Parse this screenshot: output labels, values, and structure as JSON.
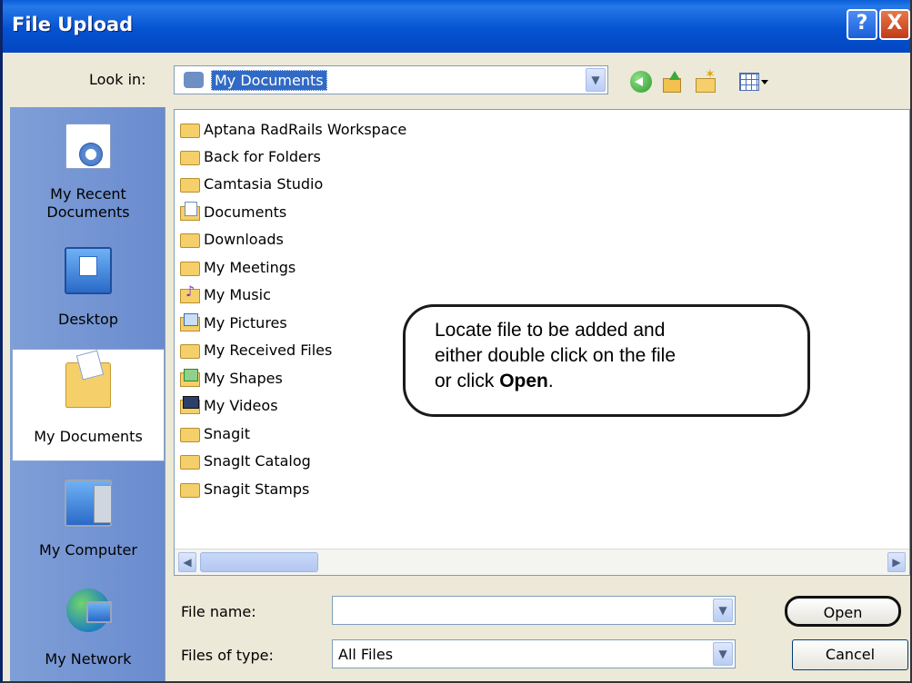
{
  "window": {
    "title": "File Upload"
  },
  "title_buttons": {
    "help": "?",
    "close": "X"
  },
  "look_in": {
    "label": "Look in:",
    "value": "My Documents"
  },
  "places": [
    {
      "label": "My Recent\nDocuments",
      "icon": "recent-documents-icon"
    },
    {
      "label": "Desktop",
      "icon": "desktop-icon"
    },
    {
      "label": "My Documents",
      "icon": "my-documents-icon",
      "selected": true
    },
    {
      "label": "My Computer",
      "icon": "my-computer-icon"
    },
    {
      "label": "My Network",
      "icon": "my-network-icon"
    }
  ],
  "files": [
    {
      "name": "Aptana RadRails Workspace",
      "icon": "folder-icon"
    },
    {
      "name": "Back for Folders",
      "icon": "folder-icon"
    },
    {
      "name": "Camtasia Studio",
      "icon": "folder-icon"
    },
    {
      "name": "Documents",
      "icon": "documents-folder-icon"
    },
    {
      "name": "Downloads",
      "icon": "folder-icon"
    },
    {
      "name": "My Meetings",
      "icon": "folder-icon"
    },
    {
      "name": "My Music",
      "icon": "music-folder-icon"
    },
    {
      "name": "My Pictures",
      "icon": "pictures-folder-icon"
    },
    {
      "name": "My Received Files",
      "icon": "folder-icon"
    },
    {
      "name": "My Shapes",
      "icon": "shapes-folder-icon"
    },
    {
      "name": "My Videos",
      "icon": "videos-folder-icon"
    },
    {
      "name": "Snagit",
      "icon": "folder-icon"
    },
    {
      "name": "SnagIt Catalog",
      "icon": "folder-icon"
    },
    {
      "name": "Snagit Stamps",
      "icon": "folder-icon"
    }
  ],
  "callout": {
    "line1": "Locate file to be added and",
    "line2": "either double click on the file",
    "line3_prefix": "or click ",
    "line3_bold": "Open",
    "line3_suffix": "."
  },
  "file_name": {
    "label": "File name:",
    "value": ""
  },
  "file_type": {
    "label": "Files of type:",
    "value": "All Files"
  },
  "buttons": {
    "open": "Open",
    "cancel": "Cancel"
  },
  "colors": {
    "titlebar": "#0553d1",
    "places_bar": "#7f9fd8",
    "selection": "#316ac5"
  }
}
